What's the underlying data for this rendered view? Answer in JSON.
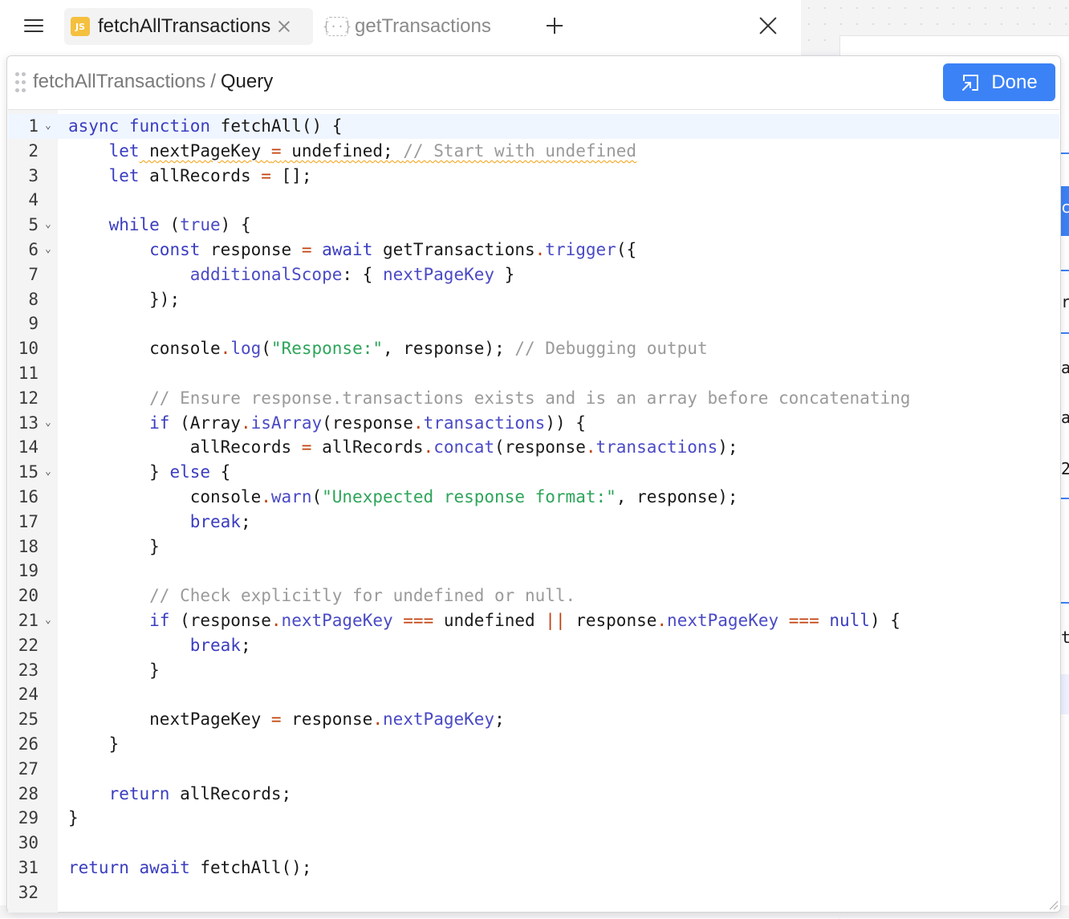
{
  "tabs": {
    "active_label": "fetchAllTransactions",
    "active_badge": "JS",
    "inactive_label": "getTransactions",
    "inactive_icon": "{··}"
  },
  "header": {
    "breadcrumb_parent": "fetchAllTransactions",
    "breadcrumb_sep": "/",
    "breadcrumb_current": "Query",
    "done_label": "Done"
  },
  "background_letters": [
    "c",
    "r",
    "a",
    "a",
    "2",
    "t"
  ],
  "code": {
    "line_numbers": [
      "1",
      "2",
      "3",
      "4",
      "5",
      "6",
      "7",
      "8",
      "9",
      "10",
      "11",
      "12",
      "13",
      "14",
      "15",
      "16",
      "17",
      "18",
      "19",
      "20",
      "21",
      "22",
      "23",
      "24",
      "25",
      "26",
      "27",
      "28",
      "29",
      "30",
      "31",
      "32"
    ],
    "tokens": {
      "l1a": "async",
      "l1b": "function",
      "l1c": " fetchAll() {",
      "l2a": "let",
      "l2b": " nextPageKey ",
      "l2c": "=",
      "l2d": " undefined; ",
      "l2e": "// Start with undefined",
      "l3a": "let",
      "l3b": " allRecords ",
      "l3c": "=",
      "l3d": " [];",
      "l5a": "while",
      "l5b": " (",
      "l5c": "true",
      "l5d": ") {",
      "l6a": "const",
      "l6b": " response ",
      "l6c": "=",
      "l6d": "await",
      "l6e": " getTransactions",
      "l6f": ".",
      "l6g": "trigger",
      "l6h": "({",
      "l7a": "additionalScope",
      "l7b": ": { ",
      "l7c": "nextPageKey",
      "l7d": " }",
      "l8a": "});",
      "l10a": "console",
      "l10b": ".",
      "l10c": "log",
      "l10d": "(",
      "l10e": "\"Response:\"",
      "l10f": ", response); ",
      "l10g": "// Debugging output",
      "l12a": "// Ensure response.transactions exists and is an array before concatenating",
      "l13a": "if",
      "l13b": " (Array",
      "l13c": ".",
      "l13d": "isArray",
      "l13e": "(response",
      "l13f": ".",
      "l13g": "transactions",
      "l13h": ")) {",
      "l14a": "allRecords ",
      "l14b": "=",
      "l14c": " allRecords",
      "l14d": ".",
      "l14e": "concat",
      "l14f": "(response",
      "l14g": ".",
      "l14h": "transactions",
      "l14i": ");",
      "l15a": "} ",
      "l15b": "else",
      "l15c": " {",
      "l16a": "console",
      "l16b": ".",
      "l16c": "warn",
      "l16d": "(",
      "l16e": "\"Unexpected response format:\"",
      "l16f": ", response);",
      "l17a": "break",
      "l17b": ";",
      "l18a": "}",
      "l20a": "// Check explicitly for undefined or null.",
      "l21a": "if",
      "l21b": " (response",
      "l21c": ".",
      "l21d": "nextPageKey",
      "l21e": "===",
      "l21f": " undefined ",
      "l21g": "||",
      "l21h": " response",
      "l21i": ".",
      "l21j": "nextPageKey",
      "l21k": "===",
      "l21l": "null",
      "l21m": ") {",
      "l22a": "break",
      "l22b": ";",
      "l23a": "}",
      "l25a": "nextPageKey ",
      "l25b": "=",
      "l25c": " response",
      "l25d": ".",
      "l25e": "nextPageKey",
      "l25f": ";",
      "l26a": "}",
      "l28a": "return",
      "l28b": " allRecords;",
      "l29a": "}",
      "l31a": "return",
      "l31b": "await",
      "l31c": " fetchAll();"
    }
  },
  "icons": {
    "menu": "hamburger-menu-icon",
    "close_tab": "close-icon",
    "new_tab": "plus-icon",
    "close_panel": "close-icon",
    "drag": "drag-handle-icon",
    "done": "collapse-icon",
    "ai": "robot-icon"
  },
  "colors": {
    "accent": "#3b82f6",
    "keyword": "#3a3dbf",
    "string": "#2da55a",
    "comment": "#9a9a9a",
    "operator": "#c2410c",
    "js_badge": "#f5c03e",
    "ai_button": "#a855c7"
  }
}
